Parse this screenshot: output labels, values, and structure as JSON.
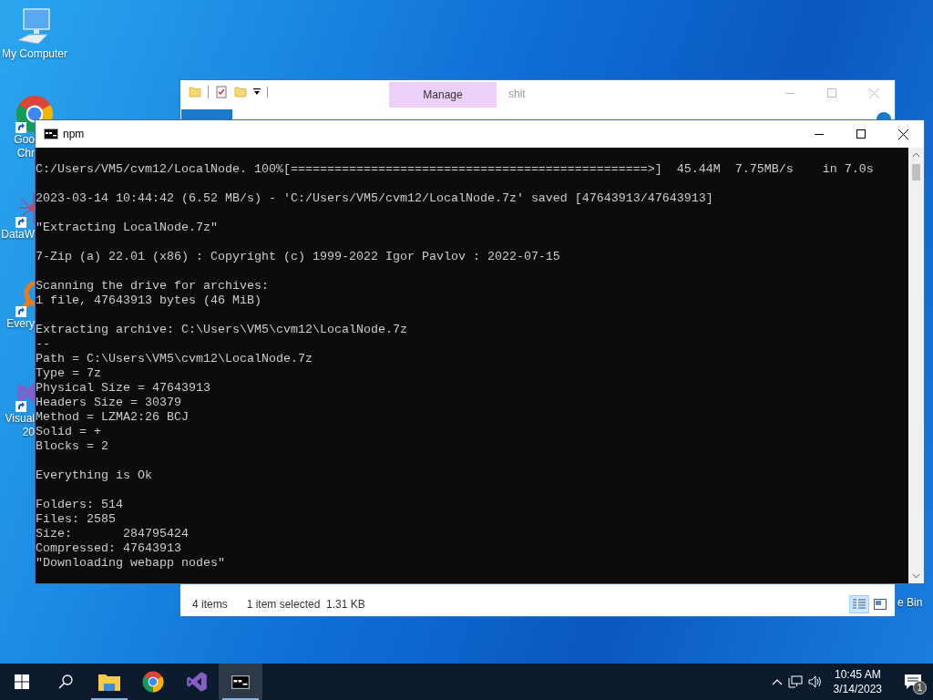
{
  "desktop_icons": [
    {
      "kind": "computer",
      "label": [
        "My Computer"
      ],
      "partial": false
    },
    {
      "kind": "chrome",
      "label": [
        "Goo",
        "Chr"
      ],
      "partial": true
    },
    {
      "kind": "data",
      "label": [
        "DataW"
      ],
      "partial": true
    },
    {
      "kind": "search",
      "label": [
        "Every"
      ],
      "partial": true
    },
    {
      "kind": "studio",
      "label": [
        "Visual",
        "20"
      ],
      "partial": true
    }
  ],
  "recycle_label": "e Bin",
  "explorer": {
    "contextual_tab": "Manage",
    "title": "shit",
    "status_bar": {
      "count": "4 items",
      "selection": "1 item selected  1.31 KB"
    },
    "views": [
      {
        "kind": "details",
        "selected": true
      },
      {
        "kind": "tiles",
        "selected": false
      }
    ]
  },
  "console": {
    "title": "npm",
    "blocks": [
      [
        "C:/Users/VM5/cvm12/LocalNode. 100%[=================================================>]  45.44M  7.75MB/s    in 7.0s"
      ],
      [
        "2023-03-14 10:44:42 (6.52 MB/s) - 'C:/Users/VM5/cvm12/LocalNode.7z' saved [47643913/47643913]"
      ],
      [
        "\"Extracting LocalNode.7z\""
      ],
      [
        "7-Zip (a) 22.01 (x86) : Copyright (c) 1999-2022 Igor Pavlov : 2022-07-15"
      ],
      [
        "Scanning the drive for archives:",
        "1 file, 47643913 bytes (46 MiB)"
      ],
      [
        "Extracting archive: C:\\Users\\VM5\\cvm12\\LocalNode.7z",
        "--",
        "Path = C:\\Users\\VM5\\cvm12\\LocalNode.7z",
        "Type = 7z",
        "Physical Size = 47643913",
        "Headers Size = 30379",
        "Method = LZMA2:26 BCJ",
        "Solid = +",
        "Blocks = 2"
      ],
      [
        "Everything is Ok"
      ],
      [
        "Folders: 514",
        "Files: 2585",
        "Size:       284795424",
        "Compressed: 47643913",
        "\"Downloading webapp nodes\""
      ]
    ]
  },
  "taskbar": {
    "apps": [
      {
        "kind": "explorer",
        "running": true,
        "selected": false
      },
      {
        "kind": "chrome",
        "running": false,
        "selected": false
      },
      {
        "kind": "studio",
        "running": false,
        "selected": false
      },
      {
        "kind": "console",
        "running": true,
        "selected": true
      }
    ],
    "clock": {
      "time": "10:45 AM",
      "date": "3/14/2023"
    },
    "notifications": "1"
  }
}
